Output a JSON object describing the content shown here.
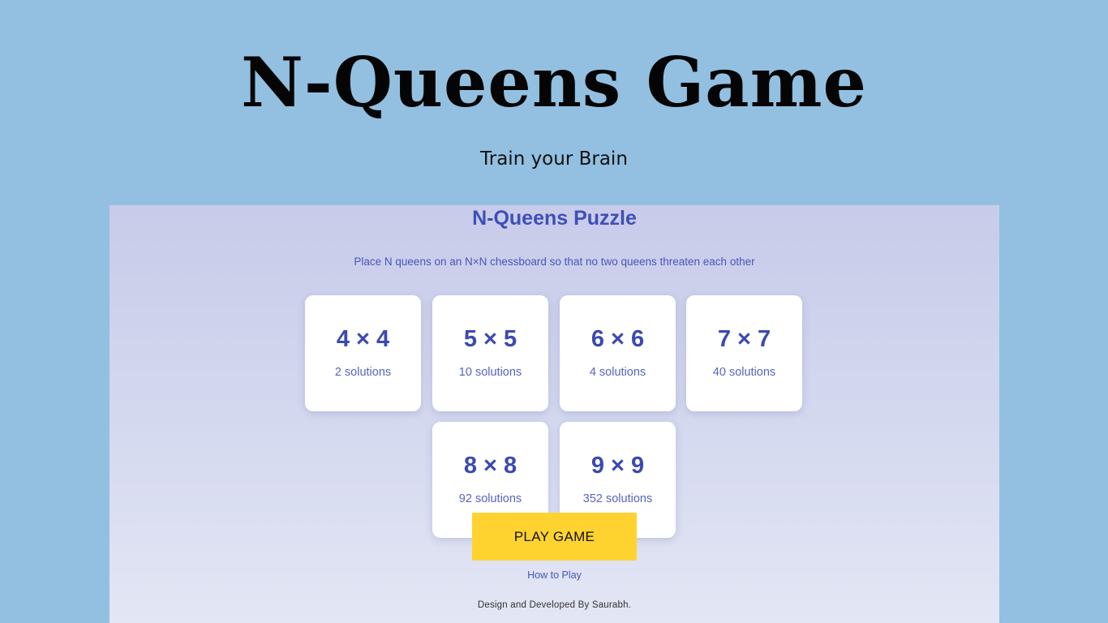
{
  "hero": {
    "title": "N-Queens Game",
    "subtitle": "Train your Brain"
  },
  "panel": {
    "title": "N-Queens Puzzle",
    "description": "Place N queens on an N×N chessboard so that no two queens threaten each other",
    "boards": [
      {
        "size": "4 × 4",
        "solutions": "2 solutions"
      },
      {
        "size": "5 × 5",
        "solutions": "10 solutions"
      },
      {
        "size": "6 × 6",
        "solutions": "4 solutions"
      },
      {
        "size": "7 × 7",
        "solutions": "40 solutions"
      },
      {
        "size": "8 × 8",
        "solutions": "92 solutions"
      },
      {
        "size": "9 × 9",
        "solutions": "352 solutions"
      }
    ],
    "play_label": "PLAY GAME",
    "how_to_play": "How to Play",
    "footer": "Design and Developed By Saurabh."
  },
  "colors": {
    "page_background": "#93c0e1",
    "accent_blue": "#3f4fb6",
    "button_yellow": "#fed330"
  }
}
